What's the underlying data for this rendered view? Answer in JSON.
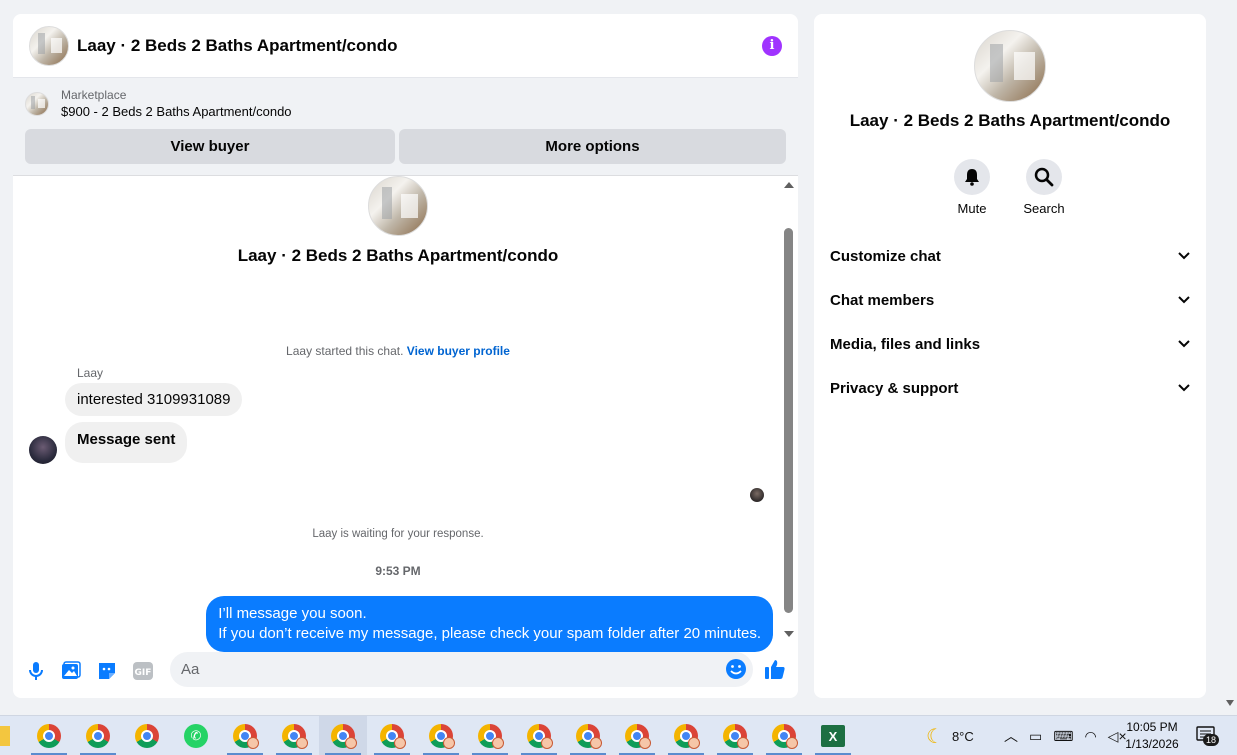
{
  "listing": {
    "title": "Laay · 2 Beds 2 Baths Apartment/condo"
  },
  "marketplace": {
    "label": "Marketplace",
    "item": "$900 - 2 Beds 2 Baths Apartment/condo",
    "view_buyer": "View buyer",
    "more_options": "More options"
  },
  "thread": {
    "started_prefix": "Laay started this chat.",
    "view_profile": "View buyer profile",
    "sender_name": "Laay",
    "incoming": [
      "interested 3109931089",
      "Message sent"
    ],
    "waiting": "Laay is waiting for your response.",
    "time": "9:53 PM",
    "outgoing_line1": "I’ll message you soon.",
    "outgoing_line2": "If you don’t receive my message, please check your spam folder after 20 minutes."
  },
  "composer": {
    "placeholder": "Aa",
    "gif_label": "GIF"
  },
  "info": {
    "mute": "Mute",
    "search": "Search",
    "sections": [
      "Customize chat",
      "Chat members",
      "Media, files and links",
      "Privacy & support"
    ]
  },
  "taskbar": {
    "weather": "8°C",
    "time": "10:05 PM",
    "date": "1/13/2026",
    "notifications": "18"
  },
  "colors": {
    "brand_blue": "#0a7cff",
    "info_purple": "#a033ff"
  }
}
